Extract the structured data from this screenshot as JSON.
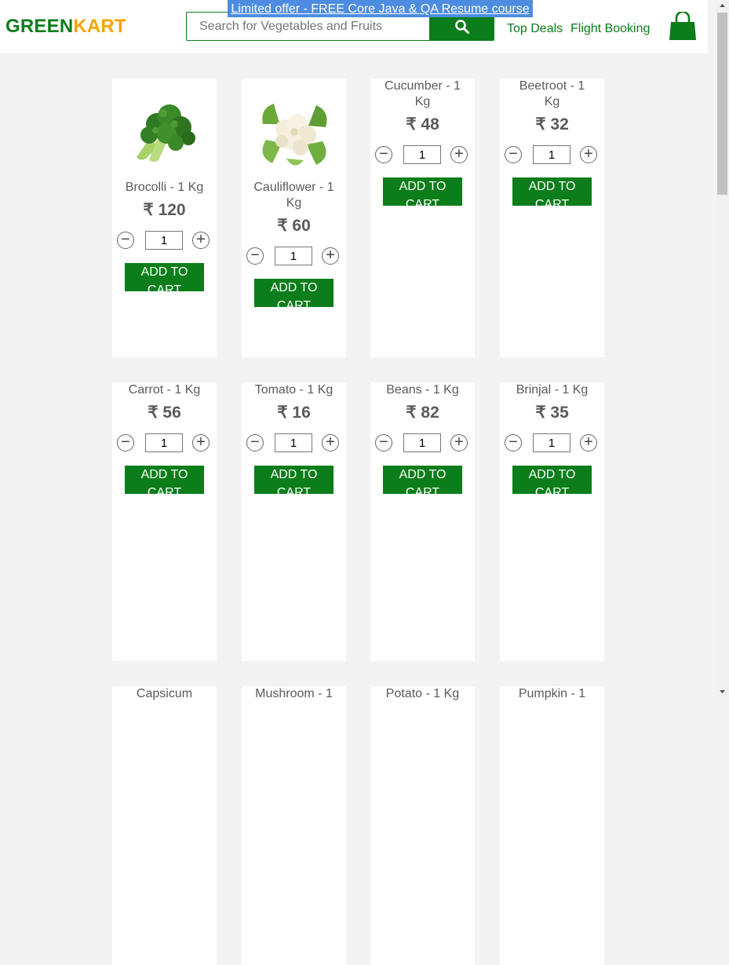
{
  "header": {
    "logo_green": "GREEN",
    "logo_kart": "KART",
    "search_placeholder": "Search for Vegetables and Fruits",
    "offer_text": "Limited offer - FREE Core Java & QA Resume course",
    "links": [
      "Top Deals",
      "Flight Booking"
    ],
    "brand_color": "#0b7d1a",
    "accent_color": "#f7a400",
    "offer_bg": "#4d8ce0"
  },
  "currency_symbol": "₹",
  "add_label": "ADD TO CART",
  "products": [
    {
      "name": "Brocolli - 1 Kg",
      "price": "₹ 120",
      "qty": "1",
      "image": "broccoli"
    },
    {
      "name": "Cauliflower - 1 Kg",
      "price": "₹ 60",
      "qty": "1",
      "image": "cauliflower"
    },
    {
      "name": "Cucumber - 1 Kg",
      "price": "₹ 48",
      "qty": "1",
      "image": ""
    },
    {
      "name": "Beetroot - 1 Kg",
      "price": "₹ 32",
      "qty": "1",
      "image": ""
    },
    {
      "name": "Carrot - 1 Kg",
      "price": "₹ 56",
      "qty": "1",
      "image": ""
    },
    {
      "name": "Tomato - 1 Kg",
      "price": "₹ 16",
      "qty": "1",
      "image": ""
    },
    {
      "name": "Beans - 1 Kg",
      "price": "₹ 82",
      "qty": "1",
      "image": ""
    },
    {
      "name": "Brinjal - 1 Kg",
      "price": "₹ 35",
      "qty": "1",
      "image": ""
    },
    {
      "name": "Capsicum",
      "price": "",
      "qty": "",
      "image": ""
    },
    {
      "name": "Mushroom - 1",
      "price": "",
      "qty": "",
      "image": ""
    },
    {
      "name": "Potato - 1 Kg",
      "price": "",
      "qty": "",
      "image": ""
    },
    {
      "name": "Pumpkin - 1",
      "price": "",
      "qty": "",
      "image": ""
    }
  ]
}
